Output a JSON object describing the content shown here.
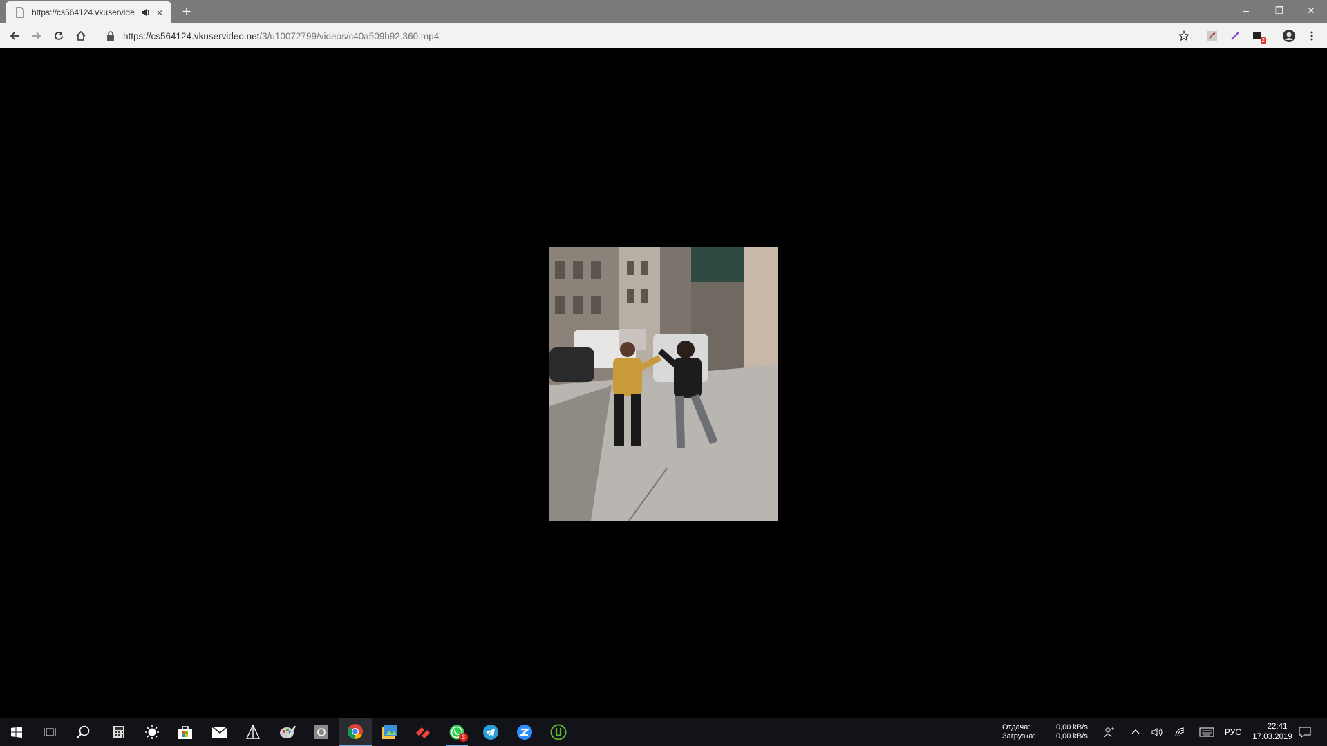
{
  "browser": {
    "tab_title": "https://cs564124.vkuservide",
    "tab_close": "×",
    "new_tab": "+",
    "url_domain": "https://cs564124.vkuservideo.net",
    "url_path": "/3/u10072799/videos/c40a509b92.360.mp4",
    "window_minimize": "–",
    "window_restore": "❐",
    "window_close": "✕",
    "extension_badge": "2"
  },
  "taskbar": {
    "pinned": [
      {
        "name": "start-button",
        "label": "Windows"
      },
      {
        "name": "task-view",
        "label": "Task View"
      },
      {
        "name": "search",
        "label": "Search"
      },
      {
        "name": "calculator",
        "label": "Calculator"
      },
      {
        "name": "weather",
        "label": "Weather"
      },
      {
        "name": "store",
        "label": "Store"
      },
      {
        "name": "mail",
        "label": "Mail"
      },
      {
        "name": "3d-viewer",
        "label": "3D"
      },
      {
        "name": "paint",
        "label": "Paint"
      },
      {
        "name": "camera",
        "label": "Camera"
      },
      {
        "name": "chrome",
        "label": "Chrome"
      },
      {
        "name": "photos",
        "label": "Photos"
      },
      {
        "name": "anydesk",
        "label": "AnyDesk"
      },
      {
        "name": "whatsapp",
        "label": "WhatsApp"
      },
      {
        "name": "telegram",
        "label": "Telegram"
      },
      {
        "name": "zoom",
        "label": "Zoom"
      },
      {
        "name": "utorrent",
        "label": "uTorrent"
      }
    ],
    "whatsapp_badge": "3",
    "net_upload_label": "Отдача:",
    "net_download_label": "Загрузка:",
    "net_upload_value": "0,00 kB/s",
    "net_download_value": "0,00 kB/s",
    "language": "РУС",
    "time": "22:41",
    "date": "17.03.2019"
  }
}
